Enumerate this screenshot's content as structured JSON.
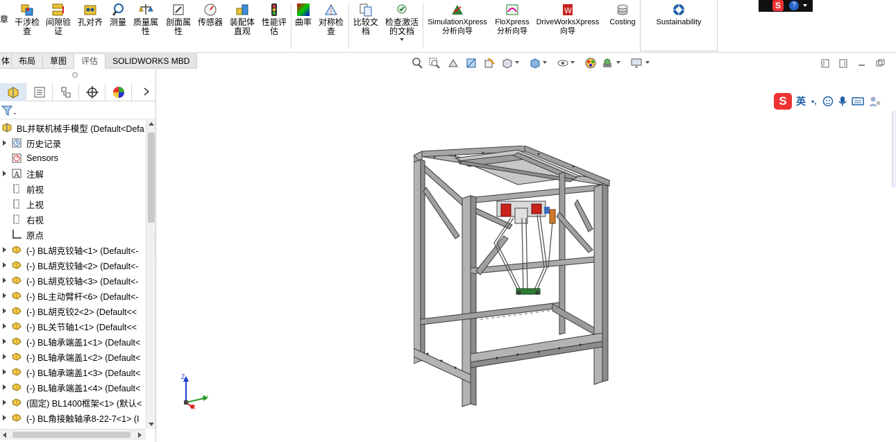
{
  "ribbon": {
    "partial_left": "章",
    "buttons": [
      {
        "label": "干涉检\n查",
        "icon": "interference-check-icon"
      },
      {
        "label": "间隙验\n证",
        "icon": "clearance-verify-icon"
      },
      {
        "label": "孔对齐",
        "icon": "hole-align-icon"
      },
      {
        "label": "测量",
        "icon": "measure-icon"
      },
      {
        "label": "质量属\n性",
        "icon": "mass-properties-icon"
      },
      {
        "label": "剖面属\n性",
        "icon": "section-properties-icon"
      },
      {
        "label": "传感器",
        "icon": "sensor-icon"
      },
      {
        "label": "装配体\n直观",
        "icon": "assembly-visualization-icon"
      },
      {
        "label": "性能评\n估",
        "icon": "performance-evaluation-icon"
      },
      {
        "label": "曲率",
        "icon": "curvature-icon"
      },
      {
        "label": "对称检\n查",
        "icon": "symmetry-check-icon"
      },
      {
        "label": "比较文\n档",
        "icon": "compare-documents-icon"
      },
      {
        "label": "检查激活\n的文档",
        "icon": "check-active-document-icon"
      },
      {
        "label": "SimulationXpress\n分析向导",
        "icon": "simulationxpress-icon"
      },
      {
        "label": "FloXpress\n分析向导",
        "icon": "floxpress-icon"
      },
      {
        "label": "DriveWorksXpress\n向导",
        "icon": "driveworksxpress-icon"
      },
      {
        "label": "Costing",
        "icon": "costing-icon"
      },
      {
        "label": "Sustainability",
        "icon": "sustainability-icon"
      }
    ]
  },
  "tabs": [
    "体",
    "布局",
    "草图",
    "评估",
    "SOLIDWORKS MBD"
  ],
  "active_tab": "评估",
  "feature_tree": {
    "root": "BL并联机械手模型  (Default<Defa",
    "items": [
      {
        "label": "历史记录",
        "expand": true,
        "icon": "history-icon"
      },
      {
        "label": "Sensors",
        "expand": false,
        "icon": "sensors-icon"
      },
      {
        "label": "注解",
        "expand": true,
        "icon": "annotations-icon"
      },
      {
        "label": "前视",
        "expand": false,
        "icon": "plane-icon"
      },
      {
        "label": "上视",
        "expand": false,
        "icon": "plane-icon"
      },
      {
        "label": "右视",
        "expand": false,
        "icon": "plane-icon"
      },
      {
        "label": "原点",
        "expand": false,
        "icon": "origin-icon"
      },
      {
        "label": "(-) BL胡克铰轴<1> (Default<-",
        "expand": true,
        "icon": "part-icon"
      },
      {
        "label": "(-) BL胡克铰轴<2> (Default<-",
        "expand": true,
        "icon": "part-icon"
      },
      {
        "label": "(-) BL胡克铰轴<3> (Default<-",
        "expand": true,
        "icon": "part-icon"
      },
      {
        "label": "(-) BL主动臂杆<6> (Default<-",
        "expand": true,
        "icon": "part-icon"
      },
      {
        "label": "(-) BL胡克铰2<2> (Default<<",
        "expand": true,
        "icon": "part-icon"
      },
      {
        "label": "(-) BL关节轴1<1> (Default<<",
        "expand": true,
        "icon": "part-icon"
      },
      {
        "label": "(-) BL轴承端盖1<1> (Default<",
        "expand": true,
        "icon": "part-icon"
      },
      {
        "label": "(-) BL轴承端盖1<2> (Default<",
        "expand": true,
        "icon": "part-icon"
      },
      {
        "label": "(-) BL轴承端盖1<3> (Default<",
        "expand": true,
        "icon": "part-icon"
      },
      {
        "label": "(-) BL轴承端盖1<4> (Default<",
        "expand": true,
        "icon": "part-icon"
      },
      {
        "label": "(固定) BL1400框架<1> (默认<",
        "expand": true,
        "icon": "part-icon"
      },
      {
        "label": "(-) BL角接触轴承8-22-7<1> (I",
        "expand": true,
        "icon": "part-icon"
      }
    ]
  },
  "triad": {
    "x": "X",
    "y": "Y",
    "z": "Z"
  },
  "ime": {
    "lang": "英",
    "punct": "•,"
  },
  "colors": {
    "accent": "#1c5fa8",
    "frame": "#a9a9a9",
    "frame_dark": "#5c5c5c",
    "red_part": "#c8231c",
    "green_part": "#2e7d32"
  }
}
